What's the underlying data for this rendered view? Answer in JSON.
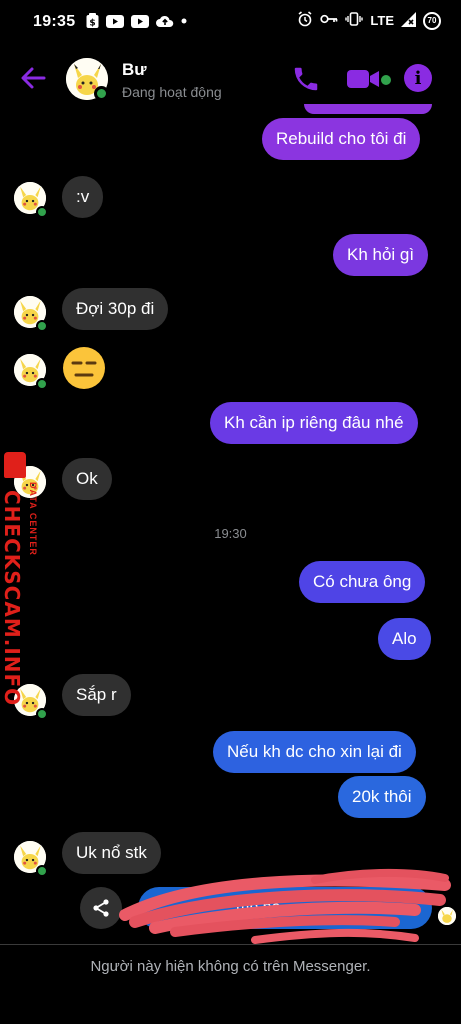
{
  "status_bar": {
    "time": "19:35",
    "network": "LTE",
    "battery": "70"
  },
  "header": {
    "name": "Bư",
    "status": "Đang hoạt động",
    "accent_color": "#8a2be2",
    "online_color": "#31a24c"
  },
  "messages": [
    {
      "side": "out",
      "text": "Rebuild cho tôi đi",
      "color": "#8b35e0"
    },
    {
      "side": "in",
      "text": ":v"
    },
    {
      "side": "out",
      "text": "Kh hỏi gì",
      "color": "#7b38e0"
    },
    {
      "side": "in",
      "text": "Đợi 30p đi"
    },
    {
      "side": "in",
      "text": "😑"
    },
    {
      "side": "out",
      "text": "Kh cần ip riêng đâu nhé",
      "color": "#6a3ae5"
    },
    {
      "side": "in",
      "text": "Ok"
    },
    {
      "side": "time",
      "text": "19:30"
    },
    {
      "side": "out",
      "text": "Có chưa ông",
      "color": "#4f44e6"
    },
    {
      "side": "out",
      "text": "Alo",
      "color": "#4a4ae6"
    },
    {
      "side": "in",
      "text": "Sắp r"
    },
    {
      "side": "out",
      "text": "Nếu kh dc cho xin lại đi",
      "color": "#2d62e0"
    },
    {
      "side": "out",
      "text": "20k thôi",
      "color": "#2a68de"
    },
    {
      "side": "in",
      "text": "Uk nổ stk"
    }
  ],
  "composer": {
    "pending_message_visible": "mb ho...",
    "bubble_color": "#1b66d1"
  },
  "watermark": {
    "main": "CHECKSCAM.INFO",
    "sub": "DATA CENTER"
  },
  "footer": {
    "note": "Người này hiện không có trên Messenger."
  }
}
